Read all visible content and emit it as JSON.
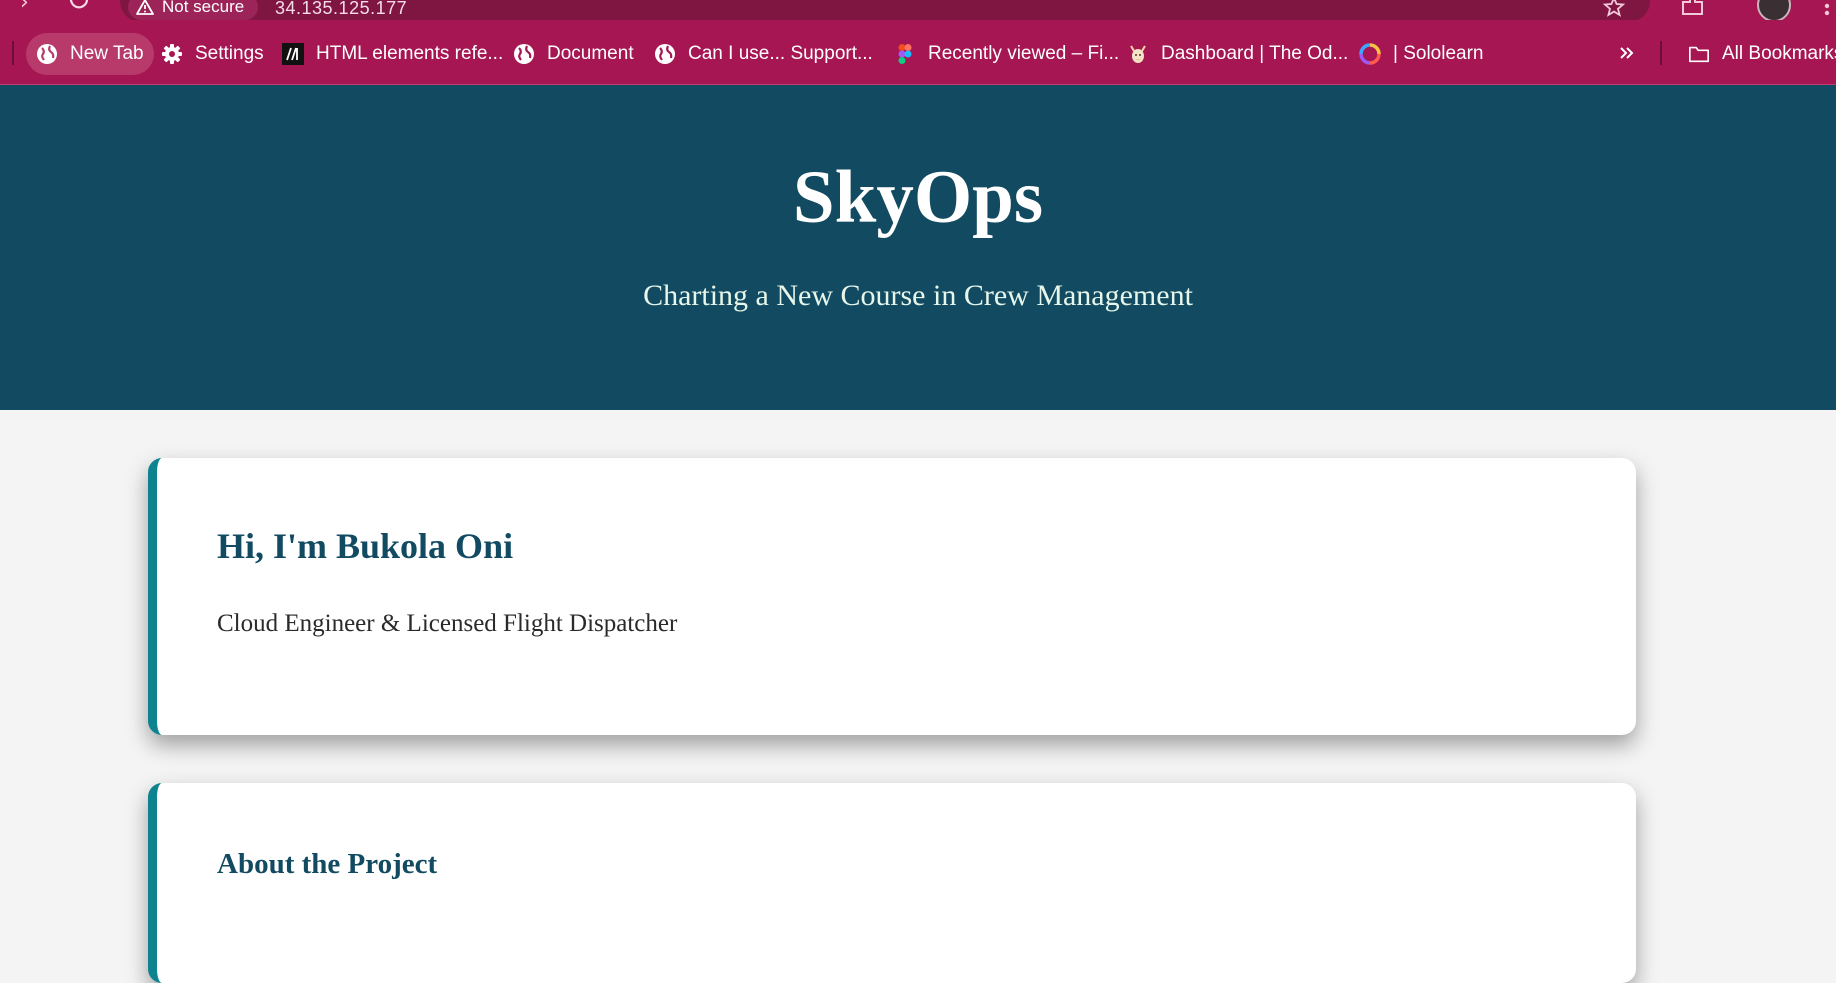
{
  "browser": {
    "security_label": "Not secure",
    "url": "34.135.125.177",
    "bookmarks": [
      {
        "label": "New Tab",
        "icon": "globe-icon"
      },
      {
        "label": "Settings",
        "icon": "gear-icon"
      },
      {
        "label": "HTML elements refe...",
        "icon": "mdn-logo-icon"
      },
      {
        "label": "Document",
        "icon": "globe-icon"
      },
      {
        "label": "Can I use... Support...",
        "icon": "globe-icon"
      },
      {
        "label": "Recently viewed – Fi...",
        "icon": "figma-icon"
      },
      {
        "label": "Dashboard | The Od...",
        "icon": "odin-icon"
      },
      {
        "label": "| Sololearn",
        "icon": "sololearn-icon"
      }
    ],
    "all_bookmarks_label": "All Bookmarks",
    "colors": {
      "chrome": "#a51652",
      "omnibox": "#7f1642"
    }
  },
  "hero": {
    "title": "SkyOps",
    "subtitle": "Charting a New Course in Crew Management",
    "background": "#124b61"
  },
  "intro_card": {
    "heading": "Hi, I'm Bukola Oni",
    "tagline": "Cloud Engineer & Licensed Flight Dispatcher",
    "accent": "#0d8390"
  },
  "about_card": {
    "heading": "About the Project"
  }
}
